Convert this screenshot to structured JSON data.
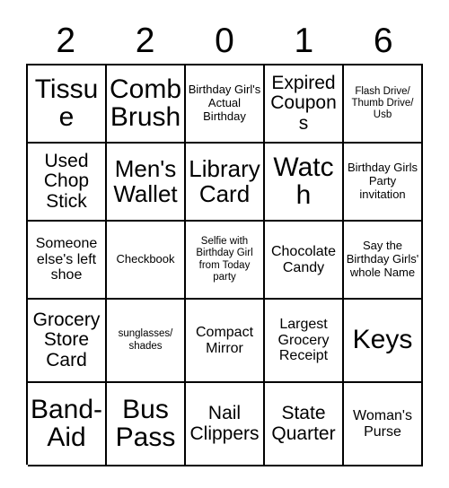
{
  "card": {
    "header_numbers": [
      "2",
      "2",
      "0",
      "1",
      "6"
    ],
    "rows": [
      [
        {
          "text": "Tissue",
          "size": "fs-xl"
        },
        {
          "text": "Comb Brush",
          "size": "fs-xl"
        },
        {
          "text": "Birthday Girl's Actual Birthday",
          "size": "fs-xs"
        },
        {
          "text": "Expired Coupons",
          "size": "fs-md"
        },
        {
          "text": "Flash Drive/ Thumb Drive/ Usb",
          "size": "fs-xxs"
        }
      ],
      [
        {
          "text": "Used Chop Stick",
          "size": "fs-md"
        },
        {
          "text": "Men's Wallet",
          "size": "fs-lg"
        },
        {
          "text": "Library Card",
          "size": "fs-lg"
        },
        {
          "text": "Watch",
          "size": "fs-xl"
        },
        {
          "text": "Birthday Girls Party invitation",
          "size": "fs-xs"
        }
      ],
      [
        {
          "text": "Someone else's left shoe",
          "size": "fs-sm"
        },
        {
          "text": "Checkbook",
          "size": "fs-xs"
        },
        {
          "text": "Selfie with Birthday Girl from Today party",
          "size": "fs-xxs"
        },
        {
          "text": "Chocolate Candy",
          "size": "fs-sm"
        },
        {
          "text": "Say the Birthday Girls' whole Name",
          "size": "fs-xs"
        }
      ],
      [
        {
          "text": "Grocery Store Card",
          "size": "fs-md"
        },
        {
          "text": "sunglasses/ shades",
          "size": "fs-xxs"
        },
        {
          "text": "Compact Mirror",
          "size": "fs-sm"
        },
        {
          "text": "Largest Grocery Receipt",
          "size": "fs-sm"
        },
        {
          "text": "Keys",
          "size": "fs-xl"
        }
      ],
      [
        {
          "text": "Band-Aid",
          "size": "fs-xl"
        },
        {
          "text": "Bus Pass",
          "size": "fs-xl"
        },
        {
          "text": "Nail Clippers",
          "size": "fs-md"
        },
        {
          "text": "State Quarter",
          "size": "fs-md"
        },
        {
          "text": "Woman's Purse",
          "size": "fs-sm"
        }
      ]
    ]
  },
  "colors": {
    "grid_line": "#000000",
    "text": "#000000",
    "background": "#ffffff"
  }
}
